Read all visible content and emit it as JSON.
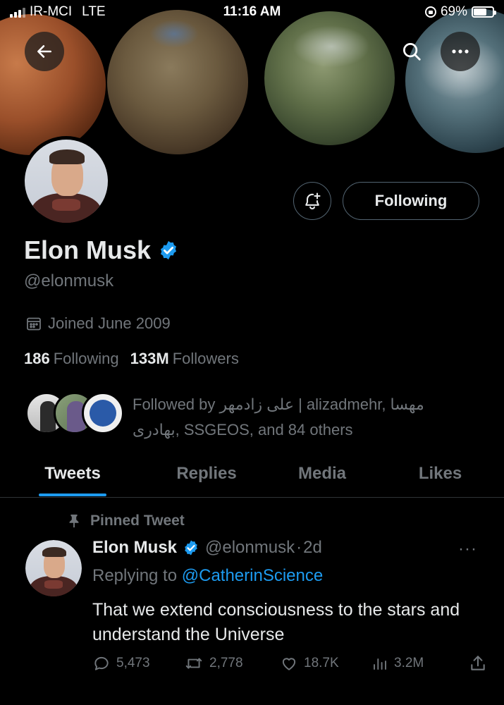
{
  "status_bar": {
    "carrier": "IR-MCI",
    "network": "LTE",
    "time": "11:16 AM",
    "battery": "69%",
    "battery_level": 0.69
  },
  "header": {
    "back_icon": "arrow-left-icon",
    "search_icon": "search-icon",
    "more_icon": "more-horizontal-icon"
  },
  "profile": {
    "display_name": "Elon Musk",
    "handle": "@elonmusk",
    "joined": "Joined June 2009",
    "following_count": "186",
    "following_label": "Following",
    "followers_count": "133M",
    "followers_label": "Followers",
    "follow_button_label": "Following",
    "notify_icon": "bell-plus-icon",
    "followed_by": "Followed by علی زادمهر | alizadmehr, مهسا بهادری, SSGEOS, and 84 others"
  },
  "tabs": [
    {
      "label": "Tweets",
      "active": true
    },
    {
      "label": "Replies",
      "active": false
    },
    {
      "label": "Media",
      "active": false
    },
    {
      "label": "Likes",
      "active": false
    }
  ],
  "tweet": {
    "pinned_label": "Pinned Tweet",
    "author_name": "Elon Musk",
    "author_handle": "@elonmusk",
    "separator": "·",
    "age": "2d",
    "replying_prefix": "Replying to",
    "replying_to": "@CatherinScience",
    "text": "That we extend consciousness to the stars and understand the Universe",
    "more": "···",
    "replies": "5,473",
    "retweets": "2,778",
    "likes": "18.7K",
    "views": "3.2M"
  },
  "colors": {
    "background": "#000000",
    "accent": "#1d9bf0",
    "text_primary": "#e7e9ea",
    "text_secondary": "#71767b"
  }
}
